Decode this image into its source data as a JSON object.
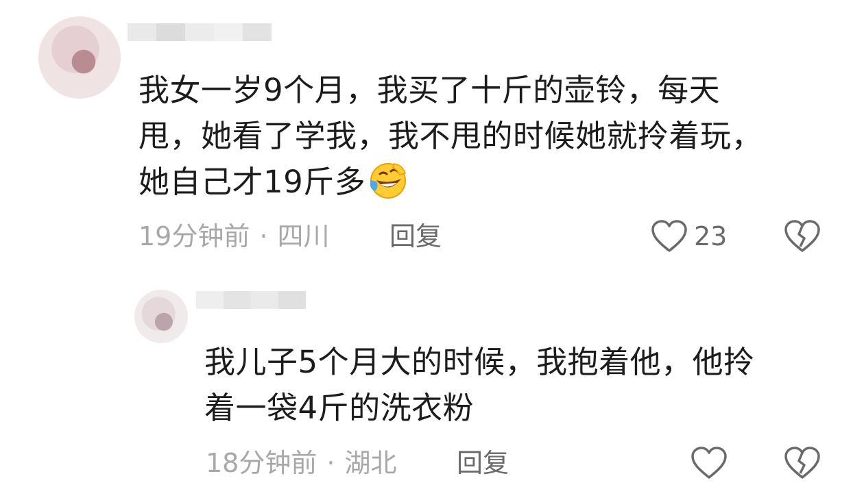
{
  "comments": [
    {
      "text_lines": [
        "我女一岁9个月，我买了十斤的壶铃，每天",
        "甩，她看了学我，我不甩的时候她就拎着玩，",
        "她自己才19斤多"
      ],
      "emoji": "rolling-on-floor-laughing-emoji",
      "time": "19分钟前",
      "location": "四川",
      "reply_label": "回复",
      "like_count": "23"
    },
    {
      "text_lines": [
        "我儿子5个月大的时候，我抱着他，他拎",
        "着一袋4斤的洗衣粉"
      ],
      "time": "18分钟前",
      "location": "湖北",
      "reply_label": "回复",
      "like_count": ""
    }
  ],
  "separator": "·",
  "colors": {
    "text": "#1c1c1c",
    "meta": "#a8a8a8",
    "icon": "#6a6a6a"
  }
}
